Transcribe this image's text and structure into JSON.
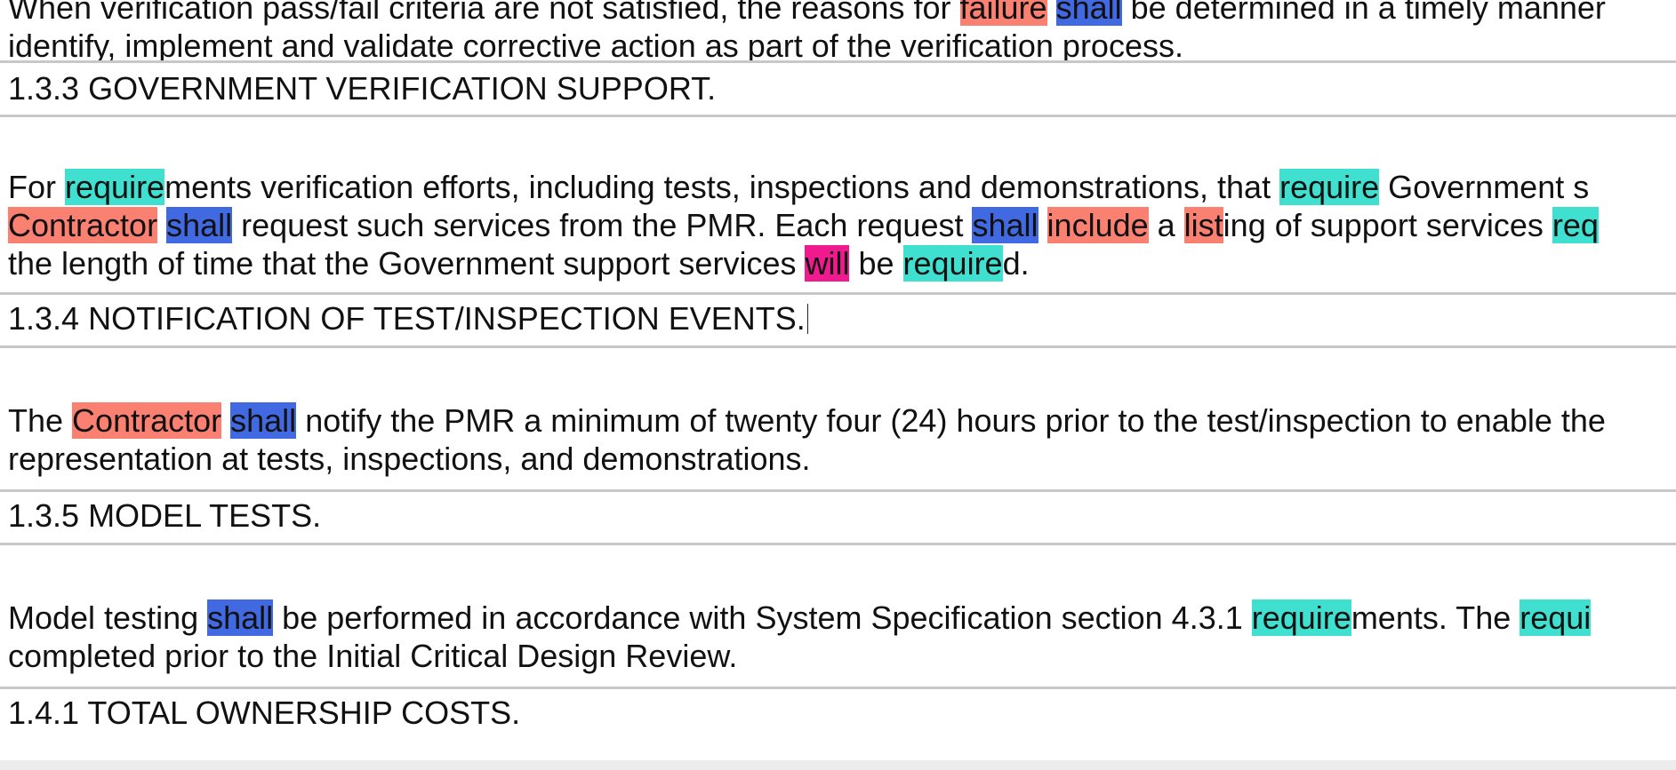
{
  "colors": {
    "salmon": "#fa8072",
    "blue": "#4169e1",
    "teal": "#40e0d0",
    "pink": "#ee1a8e",
    "separator": "#c8c8c8"
  },
  "top": {
    "line1": [
      {
        "t": "When verification pass/fail criteria are not satisfied, the reasons for "
      },
      {
        "t": "failure",
        "h": "salmon"
      },
      {
        "t": " "
      },
      {
        "t": "shall",
        "h": "blue"
      },
      {
        "t": " be determined in a timely manner"
      }
    ],
    "line2": [
      {
        "t": "identify, implement and validate corrective action as part of the verification process."
      }
    ]
  },
  "sections": [
    {
      "id": "133",
      "heading": "1.3.3 GOVERNMENT VERIFICATION SUPPORT.",
      "lines": [
        [
          {
            "t": "For "
          },
          {
            "t": "require",
            "h": "teal"
          },
          {
            "t": "ments verification efforts, including tests, inspections and demonstrations, that "
          },
          {
            "t": "require",
            "h": "teal"
          },
          {
            "t": " Government s"
          }
        ],
        [
          {
            "t": "Contractor",
            "h": "salmon"
          },
          {
            "t": " "
          },
          {
            "t": "shall",
            "h": "blue"
          },
          {
            "t": " request such services from the PMR. Each request "
          },
          {
            "t": "shall",
            "h": "blue"
          },
          {
            "t": " "
          },
          {
            "t": "include",
            "h": "salmon"
          },
          {
            "t": " a "
          },
          {
            "t": "list",
            "h": "salmon"
          },
          {
            "t": "ing of support services "
          },
          {
            "t": "req",
            "h": "teal"
          }
        ],
        [
          {
            "t": "the length of time that the Government support services "
          },
          {
            "t": "will",
            "h": "pink"
          },
          {
            "t": " be "
          },
          {
            "t": "require",
            "h": "teal"
          },
          {
            "t": "d."
          }
        ]
      ]
    },
    {
      "id": "134",
      "heading": "1.3.4 NOTIFICATION OF TEST/INSPECTION EVENTS.",
      "lines": [
        [
          {
            "t": "The "
          },
          {
            "t": "Contractor",
            "h": "salmon"
          },
          {
            "t": " "
          },
          {
            "t": "shall",
            "h": "blue"
          },
          {
            "t": " notify the PMR a minimum of twenty four (24) hours prior to the test/inspection to enable the"
          }
        ],
        [
          {
            "t": "representation at tests, inspections, and demonstrations."
          }
        ]
      ]
    },
    {
      "id": "135",
      "heading": "1.3.5 MODEL TESTS.",
      "lines": [
        [
          {
            "t": "Model testing "
          },
          {
            "t": "shall",
            "h": "blue"
          },
          {
            "t": " be performed in accordance with System Specification section 4.3.1 "
          },
          {
            "t": "require",
            "h": "teal"
          },
          {
            "t": "ments. The "
          },
          {
            "t": "requi",
            "h": "teal"
          }
        ],
        [
          {
            "t": "completed prior to the Initial Critical Design Review."
          }
        ]
      ]
    },
    {
      "id": "141",
      "heading": "1.4.1 TOTAL OWNERSHIP COSTS.",
      "lines": []
    }
  ]
}
